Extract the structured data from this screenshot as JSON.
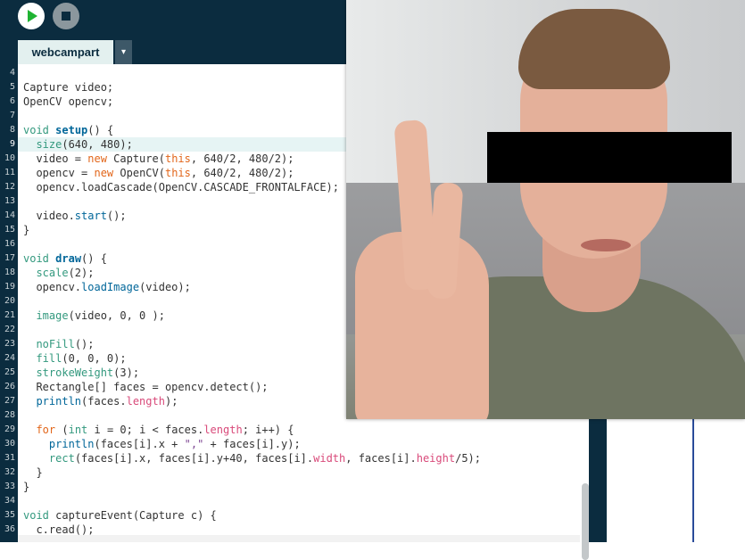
{
  "toolbar": {
    "run_button": "run",
    "stop_button": "stop",
    "tab_label": "webcampart",
    "tab_menu_glyph": "▾"
  },
  "editor": {
    "current_line": 9,
    "lines": [
      {
        "n": "4",
        "html": ""
      },
      {
        "n": "5",
        "html": "Capture video;"
      },
      {
        "n": "6",
        "html": "OpenCV opencv;"
      },
      {
        "n": "7",
        "html": ""
      },
      {
        "n": "8",
        "html": "<span class=\"kw\">void</span> <span class=\"fn\">setup</span>() {"
      },
      {
        "n": "9",
        "html": "  <span class=\"bi\">size</span>(640, 480);"
      },
      {
        "n": "10",
        "html": "  video = <span class=\"tp\">new</span> Capture(<span class=\"tp\">this</span>, 640/2, 480/2);"
      },
      {
        "n": "11",
        "html": "  opencv = <span class=\"tp\">new</span> OpenCV(<span class=\"tp\">this</span>, 640/2, 480/2);"
      },
      {
        "n": "12",
        "html": "  opencv.loadCascade(OpenCV.CASCADE_FRONTALFACE);"
      },
      {
        "n": "13",
        "html": ""
      },
      {
        "n": "14",
        "html": "  video.<span class=\"fn\" style=\"font-weight:normal\">start</span>();"
      },
      {
        "n": "15",
        "html": "}"
      },
      {
        "n": "16",
        "html": ""
      },
      {
        "n": "17",
        "html": "<span class=\"kw\">void</span> <span class=\"fn\">draw</span>() {"
      },
      {
        "n": "18",
        "html": "  <span class=\"bi\">scale</span>(2);"
      },
      {
        "n": "19",
        "html": "  opencv.<span class=\"fn\" style=\"font-weight:normal\">loadImage</span>(video);"
      },
      {
        "n": "20",
        "html": ""
      },
      {
        "n": "21",
        "html": "  <span class=\"bi\">image</span>(video, 0, 0 );"
      },
      {
        "n": "22",
        "html": ""
      },
      {
        "n": "23",
        "html": "  <span class=\"bi\">noFill</span>();"
      },
      {
        "n": "24",
        "html": "  <span class=\"bi\">fill</span>(0, 0, 0);"
      },
      {
        "n": "25",
        "html": "  <span class=\"bi\">strokeWeight</span>(3);"
      },
      {
        "n": "26",
        "html": "  Rectangle[] faces = opencv.detect();"
      },
      {
        "n": "27",
        "html": "  <span class=\"fn\" style=\"font-weight:normal\">println</span>(faces.<span class=\"pr\">length</span>);"
      },
      {
        "n": "28",
        "html": ""
      },
      {
        "n": "29",
        "html": "  <span class=\"tp\">for</span> (<span class=\"kw\">int</span> i = 0; i &lt; faces.<span class=\"pr\">length</span>; i++) {"
      },
      {
        "n": "30",
        "html": "    <span class=\"fn\" style=\"font-weight:normal\">println</span>(faces[i].x + <span class=\"st\">\",\"</span> + faces[i].y);"
      },
      {
        "n": "31",
        "html": "    <span class=\"bi\">rect</span>(faces[i].x, faces[i].y+40, faces[i].<span class=\"pr\">width</span>, faces[i].<span class=\"pr\">height</span>/5);"
      },
      {
        "n": "32",
        "html": "  }"
      },
      {
        "n": "33",
        "html": "}"
      },
      {
        "n": "34",
        "html": ""
      },
      {
        "n": "35",
        "html": "<span class=\"kw\">void</span> captureEvent(Capture c) {"
      },
      {
        "n": "36",
        "html": "  c.read();"
      }
    ]
  },
  "colors": {
    "toolbar_bg": "#0b2c3f",
    "run_green": "#1fb332",
    "keyword": "#33997e",
    "function": "#006699",
    "type": "#e2661a",
    "property": "#d94a7a",
    "string": "#7d4793"
  }
}
